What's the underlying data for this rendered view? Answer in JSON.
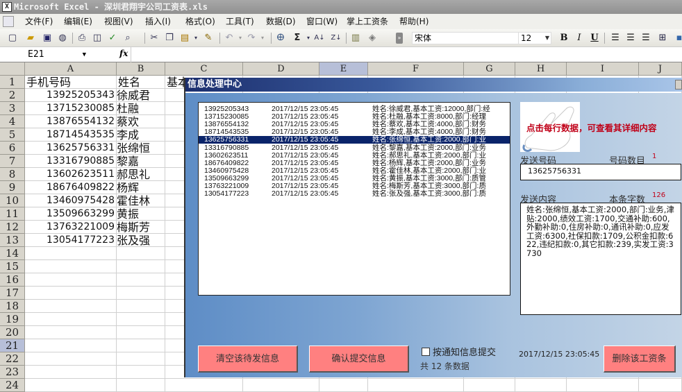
{
  "window": {
    "title": "Microsoft Excel - 深圳君翔宇公司工资表.xls",
    "app_icon": "excel-icon"
  },
  "menu": [
    "文件(F)",
    "编辑(E)",
    "视图(V)",
    "插入(I)",
    "格式(O)",
    "工具(T)",
    "数据(D)",
    "窗口(W)",
    "掌上工资条",
    "帮助(H)"
  ],
  "toolbar": {
    "icons": [
      "new-icon",
      "open-icon",
      "save-icon",
      "permission-icon",
      "print-icon",
      "print-preview-icon",
      "spelling-icon",
      "research-icon",
      "cut-icon",
      "copy-icon",
      "paste-icon",
      "format-painter-icon",
      "undo-icon",
      "redo-icon",
      "hyperlink-icon",
      "autosum-icon",
      "sort-ascending-icon",
      "sort-descending-icon",
      "chart-wizard-icon",
      "drawing-icon"
    ],
    "font_name": "宋体",
    "font_size": "12",
    "format_icons": [
      "bold-icon",
      "italic-icon",
      "underline-icon",
      "align-left-icon",
      "align-center-icon",
      "align-right-icon",
      "merge-center-icon"
    ],
    "bold": "B",
    "italic": "I",
    "underline": "U"
  },
  "formula_bar": {
    "name_box": "E21",
    "fx_label": "fx",
    "formula": ""
  },
  "sheet": {
    "columns": [
      "A",
      "B",
      "C",
      "D",
      "E",
      "F",
      "G",
      "H",
      "I",
      "J"
    ],
    "selected_column": "E",
    "selected_row": 21,
    "row_numbers": [
      "1",
      "2",
      "3",
      "4",
      "5",
      "6",
      "7",
      "8",
      "9",
      "10",
      "11",
      "12",
      "13",
      "14",
      "15",
      "16",
      "17",
      "18",
      "19",
      "20",
      "21",
      "22",
      "23",
      "24"
    ],
    "header_row": {
      "A": "手机号码",
      "B": "姓名",
      "C": "基本"
    },
    "rows": [
      {
        "phone": "13925205343",
        "name": "徐威君"
      },
      {
        "phone": "13715230085",
        "name": "杜融"
      },
      {
        "phone": "13876554132",
        "name": "蔡欢"
      },
      {
        "phone": "18714543535",
        "name": "李成"
      },
      {
        "phone": "13625756331",
        "name": "张绵恒"
      },
      {
        "phone": "13316790885",
        "name": "黎嘉"
      },
      {
        "phone": "13602623511",
        "name": "郝思礼"
      },
      {
        "phone": "18676409822",
        "name": "杨辉"
      },
      {
        "phone": "13460975428",
        "name": "霍佳林"
      },
      {
        "phone": "13509663299",
        "name": "黄振"
      },
      {
        "phone": "13763221009",
        "name": "梅斯芳"
      },
      {
        "phone": "13054177223",
        "name": "张及强"
      }
    ]
  },
  "dialog": {
    "title": "信息处理中心",
    "selected_index": 4,
    "list": [
      {
        "phone": "13925205343",
        "time": "2017/12/15 23:05:45",
        "content": "姓名:徐威君,基本工资:12000,部门:经"
      },
      {
        "phone": "13715230085",
        "time": "2017/12/15 23:05:45",
        "content": "姓名:杜融,基本工资:8000,部门:经理"
      },
      {
        "phone": "13876554132",
        "time": "2017/12/15 23:05:45",
        "content": "姓名:蔡欢,基本工资:4000,部门:财务"
      },
      {
        "phone": "18714543535",
        "time": "2017/12/15 23:05:45",
        "content": "姓名:李成,基本工资:4000,部门:财务"
      },
      {
        "phone": "13625756331",
        "time": "2017/12/15 23:05:45",
        "content": "姓名:张绵恒,基本工资:2000,部门:业"
      },
      {
        "phone": "13316790885",
        "time": "2017/12/15 23:05:45",
        "content": "姓名:黎嘉,基本工资:2000,部门:业务"
      },
      {
        "phone": "13602623511",
        "time": "2017/12/15 23:05:45",
        "content": "姓名:郝思礼,基本工资:2000,部门:业"
      },
      {
        "phone": "18676409822",
        "time": "2017/12/15 23:05:45",
        "content": "姓名:杨辉,基本工资:2000,部门:业务"
      },
      {
        "phone": "13460975428",
        "time": "2017/12/15 23:05:45",
        "content": "姓名:霍佳林,基本工资:2000,部门:业"
      },
      {
        "phone": "13509663299",
        "time": "2017/12/15 23:05:45",
        "content": "姓名:黄振,基本工资:3000,部门:质管"
      },
      {
        "phone": "13763221009",
        "time": "2017/12/15 23:05:45",
        "content": "姓名:梅斯芳,基本工资:3000,部门:质"
      },
      {
        "phone": "13054177223",
        "time": "2017/12/15 23:05:45",
        "content": "姓名:张及强,基本工资:3000,部门:质"
      }
    ],
    "hint": "点击每行数据，可查看其详细内容",
    "send_number_label": "发送号码",
    "number_count_label": "号码数目",
    "number_count": "1",
    "send_number": "13625756331",
    "send_content_label": "发送内容",
    "char_count_label": "本条字数",
    "char_count": "126",
    "send_content": "姓名:张绵恒,基本工资:2000,部门:业务,津贴:2000,绩效工资:1700,交通补助:600,外勤补助:0,住房补助:0,通讯补助:0,应发工资:6300,社保扣款:1709,公积金扣款:622,违纪扣款:0,其它扣款:239,实发工资:3730",
    "clear_button": "清空该待发信息",
    "confirm_button": "确认提交信息",
    "notify_checkbox_label": "按通知信息提交",
    "notify_checked": false,
    "total_label": "共 12 条数据",
    "timestamp": "2017/12/15 23:05:45",
    "delete_button": "删除该工资条"
  },
  "colors": {
    "selection": "#0a246a",
    "button": "#ff8080",
    "hint_red": "#c00018",
    "dialog_title_dark": "#1c2f6e"
  }
}
